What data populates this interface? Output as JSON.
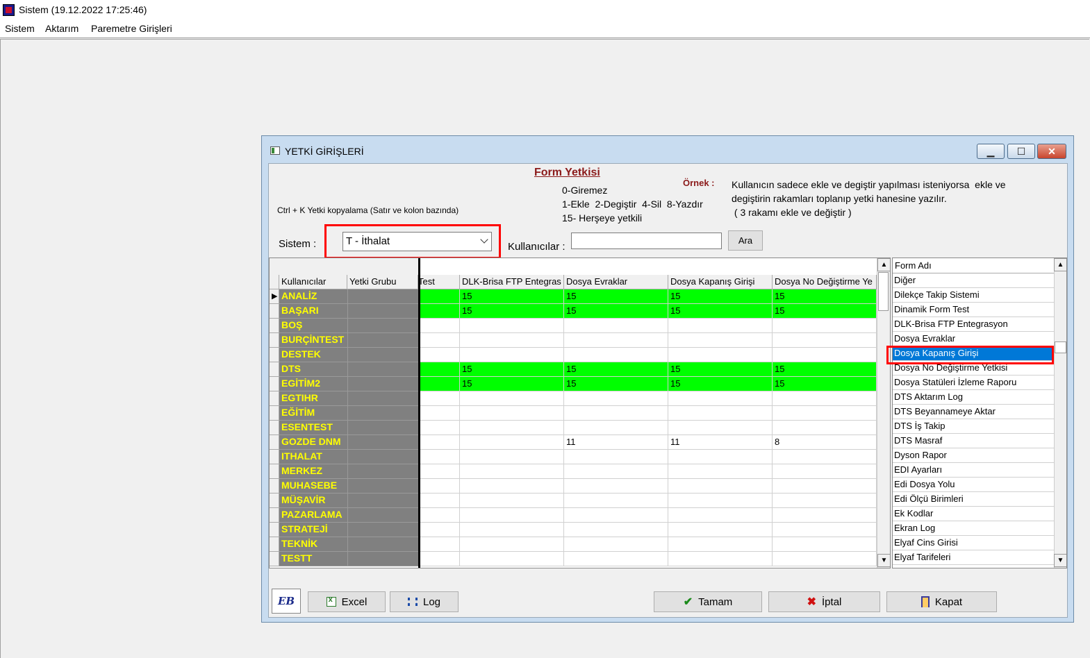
{
  "app": {
    "title": "Sistem (19.12.2022 17:25:46)"
  },
  "menu": [
    "Sistem",
    "Aktarım",
    "Paremetre Girişleri"
  ],
  "dialog": {
    "title": "YETKİ GİRİŞLERİ",
    "form_yetkisi": "Form Yetkisi",
    "ornek_label": "Örnek :",
    "legend": [
      "0-Giremez",
      "1-Ekle  2-Degiştir  4-Sil  8-Yazdır",
      "15- Herşeye yetkili"
    ],
    "ornek_text": [
      "Kullanıcın sadece ekle ve degiştir yapılması isteniyorsa  ekle ve",
      "degiştirin rakamları toplanıp yetki hanesine yazılır.",
      " ( 3 rakamı ekle ve değiştir )"
    ],
    "ctrl_hint": "Ctrl + K Yetki kopyalama (Satır ve kolon bazında)",
    "sistem_label": "Sistem :",
    "sistem_value": "T - İthalat",
    "kullanicilar_label": "Kullanıcılar :",
    "kullanicilar_value": "",
    "ara_button": "Ara"
  },
  "grid": {
    "columns": [
      "Kullanıcılar",
      "Yetki Grubu",
      "Test",
      "DLK-Brisa FTP Entegras",
      "Dosya Evraklar",
      "Dosya Kapanış Girişi",
      "Dosya No Değiştirme Ye"
    ],
    "rows": [
      {
        "user": "ANALİZ",
        "green": true,
        "vals": [
          "",
          "15",
          "15",
          "15",
          "15"
        ]
      },
      {
        "user": "BAŞARI",
        "green": true,
        "vals": [
          "",
          "15",
          "15",
          "15",
          "15"
        ]
      },
      {
        "user": "BOŞ",
        "green": false,
        "vals": [
          "",
          "",
          "",
          "",
          ""
        ]
      },
      {
        "user": "BURÇİNTEST",
        "green": false,
        "vals": [
          "",
          "",
          "",
          "",
          ""
        ]
      },
      {
        "user": "DESTEK",
        "green": false,
        "vals": [
          "",
          "",
          "",
          "",
          ""
        ]
      },
      {
        "user": "DTS",
        "green": true,
        "vals": [
          "",
          "15",
          "15",
          "15",
          "15"
        ]
      },
      {
        "user": "EGİTİM2",
        "green": true,
        "vals": [
          "",
          "15",
          "15",
          "15",
          "15"
        ]
      },
      {
        "user": "EGTIHR",
        "green": false,
        "vals": [
          "",
          "",
          "",
          "",
          ""
        ]
      },
      {
        "user": "EĞİTİM",
        "green": false,
        "vals": [
          "",
          "",
          "",
          "",
          ""
        ]
      },
      {
        "user": "ESENTEST",
        "green": false,
        "vals": [
          "",
          "",
          "",
          "",
          ""
        ]
      },
      {
        "user": "GOZDE DNM",
        "green": false,
        "vals": [
          "",
          "",
          "11",
          "11",
          "8"
        ]
      },
      {
        "user": "ITHALAT",
        "green": false,
        "vals": [
          "",
          "",
          "",
          "",
          ""
        ]
      },
      {
        "user": "MERKEZ",
        "green": false,
        "vals": [
          "",
          "",
          "",
          "",
          ""
        ]
      },
      {
        "user": "MUHASEBE",
        "green": false,
        "vals": [
          "",
          "",
          "",
          "",
          ""
        ]
      },
      {
        "user": "MÜŞAVİR",
        "green": false,
        "vals": [
          "",
          "",
          "",
          "",
          ""
        ]
      },
      {
        "user": "PAZARLAMA",
        "green": false,
        "vals": [
          "",
          "",
          "",
          "",
          ""
        ]
      },
      {
        "user": "STRATEJİ",
        "green": false,
        "vals": [
          "",
          "",
          "",
          "",
          ""
        ]
      },
      {
        "user": "TEKNİK",
        "green": false,
        "vals": [
          "",
          "",
          "",
          "",
          ""
        ]
      },
      {
        "user": "TESTT",
        "green": false,
        "vals": [
          "",
          "",
          "",
          "",
          ""
        ]
      }
    ]
  },
  "formlist": {
    "header": "Form Adı",
    "items": [
      "Diğer",
      "Dilekçe Takip Sistemi",
      "Dinamik Form Test",
      "DLK-Brisa FTP Entegrasyon",
      "Dosya Evraklar",
      "Dosya Kapanış Girişi",
      "Dosya No Değiştirme Yetkisi",
      "Dosya Statüleri İzleme Raporu",
      "DTS Aktarım Log",
      "DTS Beyannameye Aktar",
      "DTS İş Takip",
      "DTS Masraf",
      "Dyson Rapor",
      "EDI Ayarları",
      "Edi Dosya Yolu",
      "Edi Ölçü Birimleri",
      "Ek Kodlar",
      "Ekran Log",
      "Elyaf Cins Girisi",
      "Elyaf Tarifeleri"
    ],
    "selected_index": 5
  },
  "buttons": {
    "logo": "EB",
    "excel": "Excel",
    "log": "Log",
    "tamam": "Tamam",
    "iptal": "İptal",
    "kapat": "Kapat"
  },
  "colors": {
    "green": "#00ff00",
    "highlight": "#ff0000",
    "selection": "#0078d7",
    "user_text": "#ffff00"
  }
}
